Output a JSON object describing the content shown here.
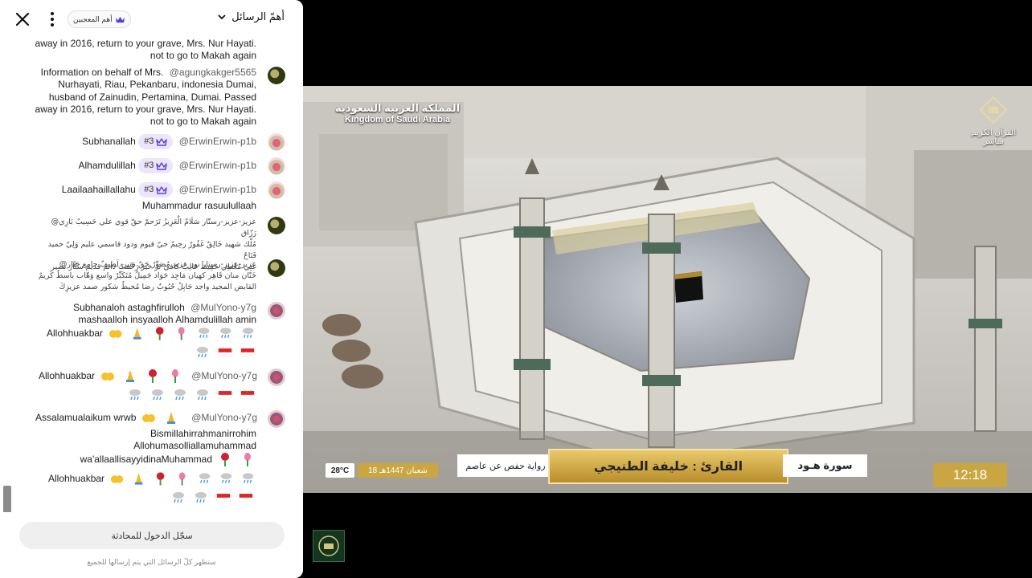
{
  "chat": {
    "header": {
      "title": "أهمّ الرسائل",
      "members_badge": "أهم المعجبين"
    },
    "messages": [
      {
        "type": "text",
        "text_lines": [
          "away in 2016, return to your grave, Mrs. Nur Hayati.",
          "not to go to Makah again"
        ]
      },
      {
        "type": "text",
        "user": "@agungkakger5565",
        "text_lines": [
          "Information on behalf of Mrs.",
          "Nurhayati, Riau, Pekanbaru, indonesia Dumai,",
          "husband of Zainudin, Pertamina, Dumai. Passed",
          "away in 2016, return to your grave, Mrs. Nur Hayati.",
          "not to go to Makah again"
        ]
      },
      {
        "type": "badge",
        "user": "@ErwinErwin-p1b",
        "badge": "#3",
        "text": "Subhanallah"
      },
      {
        "type": "badge",
        "user": "@ErwinErwin-p1b",
        "badge": "#3",
        "text": "Alhamdulillah"
      },
      {
        "type": "badge",
        "user": "@ErwinErwin-p1b",
        "badge": "#3",
        "text": "Laailaahaillallahu",
        "text2": "Muhammadur rasuulullaah"
      },
      {
        "type": "arabic",
        "text_lines": [
          "@عزيز-عزيز-رستّار  سَلَامٌ الْعَزِيزُ‌ تَرَحمّ حقّ قوي علي حَسِيبٌ بَارِي رَزّاق",
          "مُلْك شهيد خَالِقٌ غَفُورٌ رحِيمٌ حيّ قيوم ودود قاسمي عليم وَلِيّ حميد فَتَاحٌ",
          "غَنِي مُعْطِي حَفِيظُ غالِبٌ كافي نَرٌ خير رَحْمتٌ دائم قديم ستّار نصير"
        ]
      },
      {
        "type": "arabic",
        "text_lines": [
          "@عزيز-عزيز-رستار  نور عزيز مُصَوِّرٌ حَقٌ مَتِين لَطِيفٌ جامع جَبّار",
          "خَنّان منان قَاهِر كهيان مَاجِد جَوَاد جَمِيلٌ مُتَكَبِّرٌ واسع وَهّاب باسطٌ كَريمٌ",
          "القابض المجيد واجد جَابِلُ حُبُوبٌ رضا مُحيطٌ شكور صمد عزيزِكَ"
        ]
      },
      {
        "type": "text",
        "user": "@MulYono-y7g",
        "text_lines": [
          "Subhanaloh astaghfirulloh",
          "mashaalloh insyaalloh Alhamdulillah amin",
          "Allohhuakbar"
        ]
      },
      {
        "type": "text",
        "user": "@MulYono-y7g",
        "text_lines": [
          "Allohhuakbar"
        ]
      },
      {
        "type": "text",
        "user": "@MulYono-y7g",
        "text_lines": [
          "Assalamualaikum wrwb",
          "Bismillahirrahmanirrohim",
          "Allohumasolliallamuhammad",
          "wa'allaallisayyidinaMuhammad",
          "Allohhuakbar"
        ]
      }
    ],
    "login_button": "سجّل الدخول للمحادثة",
    "footer_note": "ستظهر كلّ الرسائل التي يتم إرسالها للجميع"
  },
  "video": {
    "country_ar": "المملكة العربية السعودية",
    "country_en": "Kingdom of Saudi Arabia",
    "channel_line1": "القرآن الكريم",
    "channel_line2": "مباشر",
    "temperature": "28°C",
    "date": "18 شعبان 1447هـ",
    "riwaya": "رواية حفص عن عاصم",
    "reciter": "القارئ : خليفة الطنيجي",
    "surah": "سورة هـود",
    "time": "12:18"
  },
  "colors": {
    "gold": "#c9a642",
    "badge_purple": "#ece5fb",
    "crown": "#5b3fd1"
  }
}
